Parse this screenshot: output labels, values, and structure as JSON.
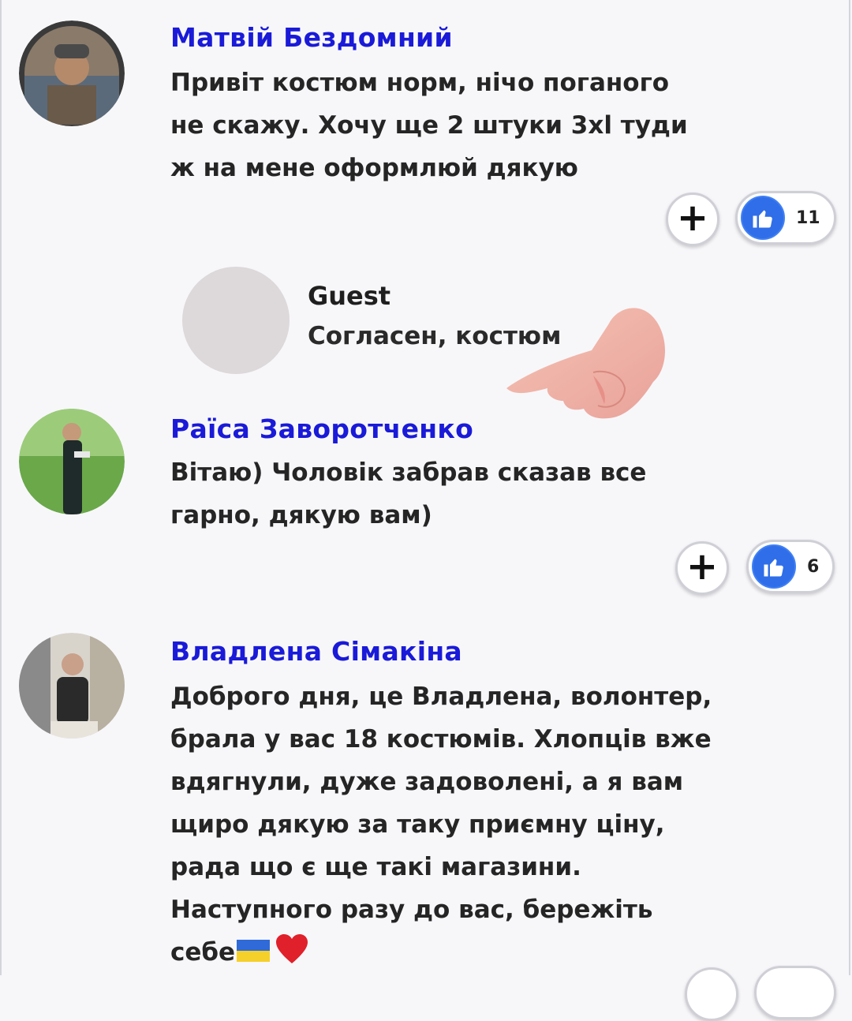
{
  "comments": [
    {
      "author": "Матвій Бездомний",
      "text": "Привіт костюм норм, нічо поганого не скажу. Хочу ще 2 штуки 3xl туди ж на мене оформлюй дякую",
      "likes": "11"
    },
    {
      "author": "Guest",
      "text": "Согласен, костюм"
    },
    {
      "author": "Раїса Заворотченко",
      "text": "Вітаю) Чоловік забрав сказав все гарно, дякую вам)",
      "likes": "6"
    },
    {
      "author": "Владлена Сімакіна",
      "text": "Доброго дня, це Владлена, волонтер, брала у вас 18 костюмів. Хлопців вже вдягнули, дуже задоволені, а я вам щиро дякую за таку приємну ціну, рада що є ще такі магазини. Наступного разу до вас, бережіть себе"
    }
  ],
  "icons": {
    "plus": "+",
    "like": "thumbs-up-icon",
    "flag": "ukraine-flag-emoji",
    "heart": "red-heart-emoji",
    "pointer": "pointing-hand-cursor"
  },
  "colors": {
    "author_name": "#1a1ad8",
    "like_blue": "#2f6ee8",
    "background": "#f7f7fa"
  }
}
